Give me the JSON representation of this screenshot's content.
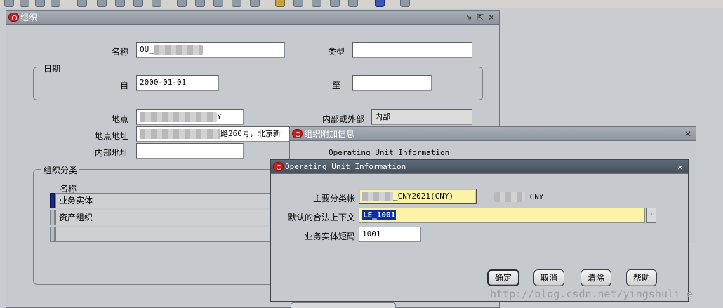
{
  "main_window": {
    "title": "组织",
    "fields": {
      "name_label": "名称",
      "name_value": "OU_",
      "type_label": "类型",
      "type_value": "",
      "date_group": "日期",
      "from_label": "自",
      "from_value": "2000-01-01",
      "to_label": "至",
      "to_value": "",
      "location_label": "地点",
      "location_value_suffix": "Y",
      "internal_external_label": "内部或外部",
      "internal_external_value": "内部",
      "location_address_label": "地点地址",
      "location_address_value": "路260号，北京新",
      "internal_address_label": "内部地址",
      "internal_address_value": ""
    },
    "classification": {
      "group_label": "组织分类",
      "column_name": "名称",
      "rows": [
        "业务实体",
        "资产组织",
        ""
      ]
    }
  },
  "addl_window": {
    "title": "组织附加信息",
    "context_text": "Operating Unit Information"
  },
  "dialog": {
    "title": "Operating Unit Information",
    "primary_ledger_label": "主要分类帐",
    "primary_ledger_value": "_CNY2021(CNY)",
    "primary_ledger_extra": "_CNY",
    "default_legal_context_label": "默认的合法上下文",
    "default_legal_context_value": "LE_1001",
    "ou_short_code_label": "业务实体短码",
    "ou_short_code_value": "1001",
    "buttons": {
      "ok": "确定",
      "cancel": "取消",
      "clear": "清除",
      "help": "帮助"
    }
  },
  "watermark": "http://blog.csdn.net/yingshuli_e",
  "colors": {
    "title_bar": "#8d949c",
    "dialog_title": "#46505c",
    "required_field": "#fbf4a6",
    "selection": "#0b2fa3"
  }
}
